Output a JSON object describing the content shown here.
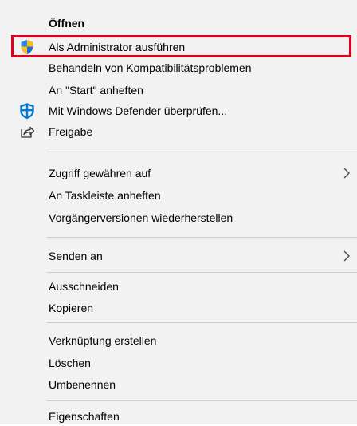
{
  "menu": {
    "items": [
      {
        "label": "Öffnen"
      },
      {
        "label": "Als Administrator ausführen",
        "icon": "uac-shield-icon"
      },
      {
        "label": "Behandeln von Kompatibilitätsproblemen"
      },
      {
        "label": "An \"Start\" anheften"
      },
      {
        "label": "Mit Windows Defender überprüfen...",
        "icon": "windows-defender-icon"
      },
      {
        "label": "Freigabe",
        "icon": "share-icon"
      },
      {
        "label": "Zugriff gewähren auf",
        "submenu": true
      },
      {
        "label": "An Taskleiste anheften"
      },
      {
        "label": "Vorgängerversionen wiederherstellen"
      },
      {
        "label": "Senden an",
        "submenu": true
      },
      {
        "label": "Ausschneiden"
      },
      {
        "label": "Kopieren"
      },
      {
        "label": "Verknüpfung erstellen"
      },
      {
        "label": "Löschen"
      },
      {
        "label": "Umbenennen"
      },
      {
        "label": "Eigenschaften"
      }
    ],
    "highlight_color": "#e0001b",
    "background_color": "#f2f2f2",
    "shield_colors": [
      "#1f6fd6",
      "#f4c01e"
    ],
    "defender_color": "#0078d7"
  }
}
